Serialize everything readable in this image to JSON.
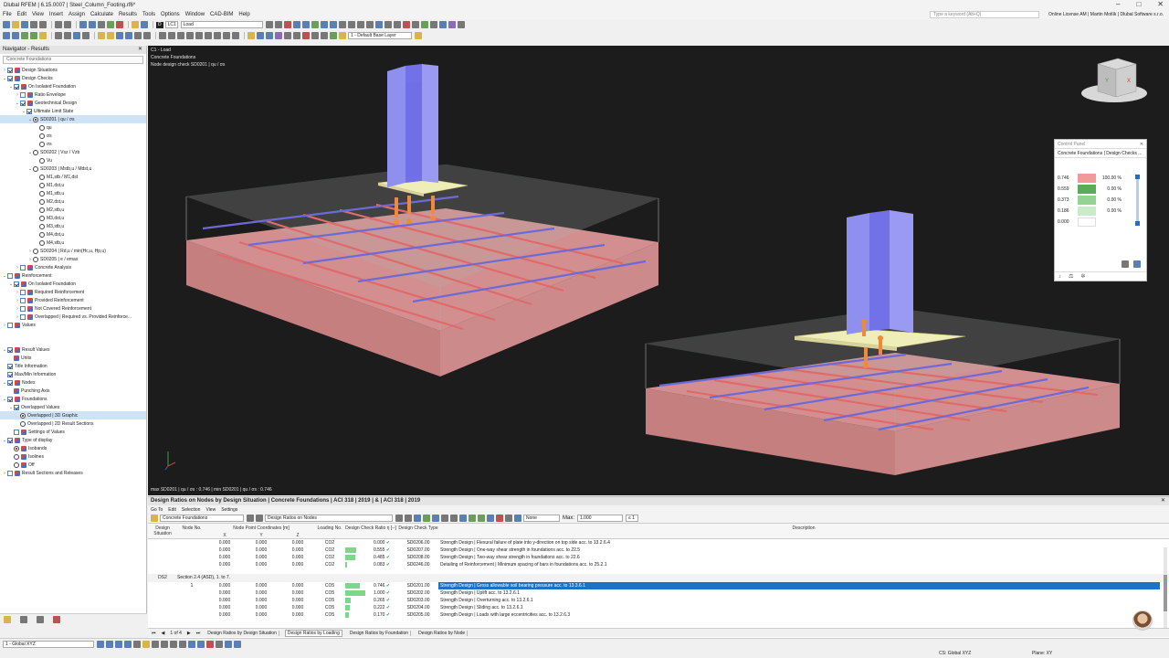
{
  "window": {
    "title": "Dlubal RFEM | 6.15.0007 | Steel_Column_Footing.rf6*"
  },
  "menu": [
    "File",
    "Edit",
    "View",
    "Insert",
    "Assign",
    "Calculate",
    "Results",
    "Tools",
    "Options",
    "Window",
    "CAD-BIM",
    "Help"
  ],
  "menu_right": {
    "search_placeholder": "Type a keyword (Alt+Q)",
    "license": "Online License AM | Martin Motlík | Dlubal Software s.r.o."
  },
  "toolbar": {
    "lc_badge": "D",
    "lc_id": "LC1",
    "lc_name": "Load",
    "layer": "1 - Default Base Layer"
  },
  "navigator": {
    "title": "Navigator - Results",
    "combo": "Concrete Foundations",
    "tree": [
      {
        "label": "Design Situations",
        "indent": 0,
        "exp": "›",
        "mark": "chk",
        "on": true,
        "icon": true
      },
      {
        "label": "Design Checks",
        "indent": 0,
        "exp": "⌄",
        "mark": "chk",
        "on": true,
        "icon": true
      },
      {
        "label": "On Isolated Foundation",
        "indent": 1,
        "exp": "⌄",
        "mark": "chk",
        "on": true,
        "icon": true
      },
      {
        "label": "Ratio Envelope",
        "indent": 2,
        "exp": "›",
        "mark": "chk",
        "on": false,
        "icon": true
      },
      {
        "label": "Geotechnical Design",
        "indent": 2,
        "exp": "⌄",
        "mark": "chk",
        "on": true,
        "icon": true
      },
      {
        "label": "Ultimate Limit State",
        "indent": 3,
        "exp": "⌄",
        "mark": "chk",
        "on": true,
        "icon": false
      },
      {
        "label": "SD0201 | qu / σs",
        "indent": 4,
        "exp": "⌄",
        "mark": "rad",
        "on": true,
        "icon": false,
        "sel": true
      },
      {
        "label": "qu",
        "indent": 5,
        "exp": "",
        "mark": "rad",
        "on": false,
        "icon": false
      },
      {
        "label": "σs",
        "indent": 5,
        "exp": "",
        "mark": "rad",
        "on": false,
        "icon": false
      },
      {
        "label": "σs",
        "indent": 5,
        "exp": "",
        "mark": "rad",
        "on": false,
        "icon": false
      },
      {
        "label": "SD0202 | Vsz / Vzb",
        "indent": 4,
        "exp": "⌄",
        "mark": "rad",
        "on": false,
        "icon": false
      },
      {
        "label": "Vu",
        "indent": 5,
        "exp": "",
        "mark": "rad",
        "on": false,
        "icon": false
      },
      {
        "label": "SD0203 | Mstb,u / Mdst,u",
        "indent": 4,
        "exp": "⌄",
        "mark": "rad",
        "on": false,
        "icon": false
      },
      {
        "label": "M1,stb / M1,dst",
        "indent": 5,
        "exp": "",
        "mark": "rad",
        "on": false,
        "icon": false
      },
      {
        "label": "M1,dst,u",
        "indent": 5,
        "exp": "",
        "mark": "rad",
        "on": false,
        "icon": false
      },
      {
        "label": "M1,stb,u",
        "indent": 5,
        "exp": "",
        "mark": "rad",
        "on": false,
        "icon": false
      },
      {
        "label": "M2,dst,u",
        "indent": 5,
        "exp": "",
        "mark": "rad",
        "on": false,
        "icon": false
      },
      {
        "label": "M2,stb,u",
        "indent": 5,
        "exp": "",
        "mark": "rad",
        "on": false,
        "icon": false
      },
      {
        "label": "M3,dst,u",
        "indent": 5,
        "exp": "",
        "mark": "rad",
        "on": false,
        "icon": false
      },
      {
        "label": "M3,stb,u",
        "indent": 5,
        "exp": "",
        "mark": "rad",
        "on": false,
        "icon": false
      },
      {
        "label": "M4,dst,u",
        "indent": 5,
        "exp": "",
        "mark": "rad",
        "on": false,
        "icon": false
      },
      {
        "label": "M4,stb,u",
        "indent": 5,
        "exp": "",
        "mark": "rad",
        "on": false,
        "icon": false
      },
      {
        "label": "SD0204 | Rd,u / min(Hc,u, Hp,u)",
        "indent": 4,
        "exp": "›",
        "mark": "rad",
        "on": false,
        "icon": false
      },
      {
        "label": "SD0205 | e / emax",
        "indent": 4,
        "exp": "›",
        "mark": "rad",
        "on": false,
        "icon": false
      },
      {
        "label": "Concrete Analysis",
        "indent": 2,
        "exp": "›",
        "mark": "chk",
        "on": false,
        "icon": true
      },
      {
        "label": "Reinforcement",
        "indent": 0,
        "exp": "⌄",
        "mark": "chk",
        "on": false,
        "icon": true
      },
      {
        "label": "On Isolated Foundation",
        "indent": 1,
        "exp": "⌄",
        "mark": "chk",
        "on": true,
        "icon": true
      },
      {
        "label": "Required Reinforcement",
        "indent": 2,
        "exp": "›",
        "mark": "chk",
        "on": false,
        "icon": true
      },
      {
        "label": "Provided Reinforcement",
        "indent": 2,
        "exp": "›",
        "mark": "chk",
        "on": false,
        "icon": true
      },
      {
        "label": "Not Covered Reinforcement",
        "indent": 2,
        "exp": "›",
        "mark": "chk",
        "on": false,
        "icon": true
      },
      {
        "label": "Overlapped | Required vs. Provided Reinforce...",
        "indent": 2,
        "exp": "›",
        "mark": "chk",
        "on": false,
        "icon": true
      },
      {
        "label": "Values",
        "indent": 0,
        "exp": "›",
        "mark": "chk",
        "on": false,
        "icon": true
      },
      {
        "label": "",
        "indent": 0,
        "exp": "",
        "mark": "none",
        "on": false,
        "icon": false
      },
      {
        "label": "",
        "indent": 0,
        "exp": "",
        "mark": "none",
        "on": false,
        "icon": false
      },
      {
        "label": "Result Values",
        "indent": 0,
        "exp": "⌄",
        "mark": "chk",
        "on": true,
        "icon": true
      },
      {
        "label": "Units",
        "indent": 1,
        "exp": "",
        "mark": "none",
        "on": false,
        "icon": true
      },
      {
        "label": "Title Information",
        "indent": 0,
        "exp": "",
        "mark": "chk",
        "on": true,
        "icon": false
      },
      {
        "label": "Max/Min Information",
        "indent": 0,
        "exp": "",
        "mark": "chk",
        "on": true,
        "icon": false
      },
      {
        "label": "Nodes",
        "indent": 0,
        "exp": "⌄",
        "mark": "chk",
        "on": true,
        "icon": true
      },
      {
        "label": "Punching Axis",
        "indent": 1,
        "exp": "",
        "mark": "none",
        "on": false,
        "icon": true
      },
      {
        "label": "Foundations",
        "indent": 0,
        "exp": "⌄",
        "mark": "chk",
        "on": true,
        "icon": true
      },
      {
        "label": "Overlapped Values",
        "indent": 1,
        "exp": "⌄",
        "mark": "chk",
        "on": true,
        "icon": false
      },
      {
        "label": "Overlapped | 3D Graphic",
        "indent": 2,
        "exp": "",
        "mark": "rad",
        "on": true,
        "icon": false,
        "sel": true
      },
      {
        "label": "Overlapped | 2D Result Sections",
        "indent": 2,
        "exp": "",
        "mark": "rad",
        "on": false,
        "icon": false
      },
      {
        "label": "Settings of Values",
        "indent": 1,
        "exp": "",
        "mark": "chk",
        "on": false,
        "icon": true
      },
      {
        "label": "Type of display",
        "indent": 0,
        "exp": "⌄",
        "mark": "chk",
        "on": true,
        "icon": true
      },
      {
        "label": "Isobands",
        "indent": 1,
        "exp": "",
        "mark": "rad",
        "on": true,
        "icon": true
      },
      {
        "label": "Isolines",
        "indent": 1,
        "exp": "",
        "mark": "rad",
        "on": false,
        "icon": true
      },
      {
        "label": "Off",
        "indent": 1,
        "exp": "",
        "mark": "rad",
        "on": false,
        "icon": true
      },
      {
        "label": "Result Sections and Releases",
        "indent": 0,
        "exp": "›",
        "mark": "chk",
        "on": false,
        "icon": true
      }
    ]
  },
  "viewport": {
    "line1": "C1 - Load",
    "line2": "Concrete Foundations",
    "line3": "Node design check SD0201 | qu / σs",
    "footer": "max SD0201 | qu / σs : 0.746 | min SD0201 | qu / σs : 0.746"
  },
  "control_panel": {
    "title": "Control Panel",
    "subtitle": "Concrete Foundations | Design Checks ...",
    "legend": [
      {
        "value": "0.746",
        "color": "#f19a9a",
        "pct": "100.00 %"
      },
      {
        "value": "0.559",
        "color": "#5aab5a",
        "pct": "0.00 %"
      },
      {
        "value": "0.373",
        "color": "#93d393",
        "pct": "0.00 %"
      },
      {
        "value": "0.186",
        "color": "#c8ecc8",
        "pct": "0.00 %"
      },
      {
        "value": "0.000",
        "color": "#ffffff",
        "pct": ""
      }
    ]
  },
  "results": {
    "title": "Design Ratios on Nodes by Design Situation | Concrete Foundations | ACI 318 | 2019 | & | ACI 318 | 2019",
    "menu": [
      "Go To",
      "Edit",
      "Selection",
      "View",
      "Settings"
    ],
    "combo_left": "Concrete Foundations",
    "combo_mid": "Design Ratios on Nodes",
    "filter": "None",
    "max_label": "Max:",
    "max_value": "1.000",
    "max_op": "≤ 1",
    "headers": {
      "situation": "Design Situation",
      "node": "Node No.",
      "coords": "Node Point Coordinates [m]",
      "x": "X",
      "y": "Y",
      "z": "Z",
      "loading": "Loading No.",
      "ratio": "Design Check Ratio η [--]",
      "type": "Design Check Type",
      "desc": "Description"
    },
    "rows_top": [
      {
        "x": "0.000",
        "y": "0.000",
        "z": "0.000",
        "lc": "CO2",
        "ratio": "0.000",
        "bar": 0,
        "type": "SD0206.00",
        "desc": "Strength Design | Flexural failure of plate into y-direction on top side acc. to 13.2.6.4"
      },
      {
        "x": "0.000",
        "y": "0.000",
        "z": "0.000",
        "lc": "CO2",
        "ratio": "0.555",
        "bar": 0.555,
        "type": "SD0207.00",
        "desc": "Strength Design | One-way shear strength in foundations acc. to 22.5"
      },
      {
        "x": "0.000",
        "y": "0.000",
        "z": "0.000",
        "lc": "CO2",
        "ratio": "0.485",
        "bar": 0.485,
        "type": "SD0208.00",
        "desc": "Strength Design | Two-way shear strength in foundations acc. to 22.6"
      },
      {
        "x": "0.000",
        "y": "0.000",
        "z": "0.000",
        "lc": "CO2",
        "ratio": "0.083",
        "bar": 0.083,
        "type": "SD0246.00",
        "desc": "Detailing of Reinforcement | Minimum spacing of bars in foundations acc. to 25.2.1"
      }
    ],
    "group": {
      "id": "DS2",
      "label": "Section 2.4 (ASD), 1. to 7."
    },
    "rows_bottom": [
      {
        "node": "1",
        "x": "0.000",
        "y": "0.000",
        "z": "0.000",
        "lc": "CO5",
        "ratio": "0.746",
        "bar": 0.746,
        "type": "SD0201.00",
        "desc": "Strength Design | Gross allowable soil bearing pressure acc. to 13.3.6.1",
        "sel": true
      },
      {
        "node": "",
        "x": "0.000",
        "y": "0.000",
        "z": "0.000",
        "lc": "CO5",
        "ratio": "1.000",
        "bar": 1.0,
        "type": "SD0202.00",
        "desc": "Strength Design | Uplift acc. to 13.2.6.1"
      },
      {
        "node": "",
        "x": "0.000",
        "y": "0.000",
        "z": "0.000",
        "lc": "CO5",
        "ratio": "0.265",
        "bar": 0.265,
        "type": "SD0203.00",
        "desc": "Strength Design | Overturning acc. to 13.2.6.1"
      },
      {
        "node": "",
        "x": "0.000",
        "y": "0.000",
        "z": "0.000",
        "lc": "CO5",
        "ratio": "0.222",
        "bar": 0.222,
        "type": "SD0204.00",
        "desc": "Strength Design | Sliding acc. to 13.2.6.1"
      },
      {
        "node": "",
        "x": "0.000",
        "y": "0.000",
        "z": "0.000",
        "lc": "CO5",
        "ratio": "0.170",
        "bar": 0.17,
        "type": "SD0205.00",
        "desc": "Strength Design | Loads with large eccentricities acc. to 13.2.6.3"
      }
    ],
    "pager": "1 of 4",
    "tabs": [
      "Design Ratios by Design Situation",
      "Design Ratios by Loading",
      "Design Ratios by Foundation",
      "Design Ratios by Node"
    ]
  },
  "status": {
    "left_combo": "1 - Global XYZ",
    "cs": "CS: Global XYZ",
    "plane": "Plane: XY"
  }
}
